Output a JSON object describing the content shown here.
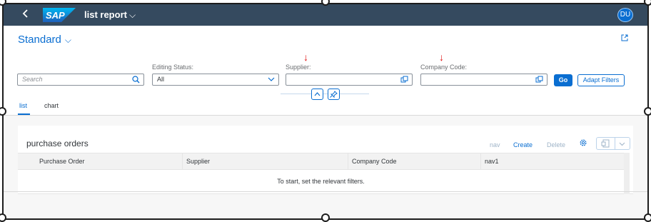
{
  "shell": {
    "back_icon": "chevron-left-icon",
    "logo": "SAP",
    "app_title": "list report",
    "app_title_chevron": "⌵",
    "user_initials": "DU"
  },
  "header": {
    "variant_label": "Standard",
    "variant_chevron": "⌵",
    "share_icon": "share-icon"
  },
  "filters": {
    "search": {
      "placeholder": "Search",
      "icon": "search-icon"
    },
    "editing_status": {
      "label": "Editing Status:",
      "value": "All",
      "icon": "chevron-down-icon"
    },
    "supplier": {
      "label": "Supplier:",
      "value": "",
      "icon": "value-help-icon"
    },
    "company_code": {
      "label": "Company Code:",
      "value": "",
      "icon": "value-help-icon"
    },
    "go_label": "Go",
    "adapt_label": "Adapt Filters",
    "annotation_arrow": "↓"
  },
  "tabs": [
    {
      "label": "list",
      "active": true
    },
    {
      "label": "chart",
      "active": false
    }
  ],
  "table": {
    "title": "purchase orders",
    "toolbar": {
      "nav": "nav",
      "create": "Create",
      "delete": "Delete"
    },
    "columns": [
      "Purchase Order",
      "Supplier",
      "Company Code",
      "nav1"
    ],
    "no_data_text": "To start, set the relevant filters."
  },
  "colors": {
    "shell_bg": "#354a5f",
    "accent": "#0a6ed1",
    "annotation": "#e01010"
  }
}
